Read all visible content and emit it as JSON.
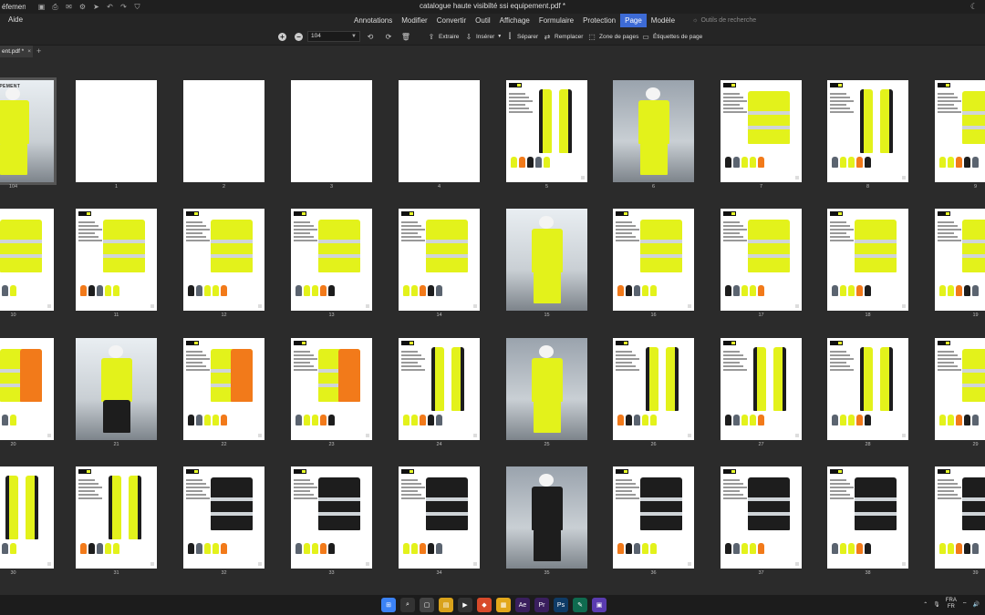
{
  "titlebar": {
    "app_name": "éfement",
    "document_title": "catalogue haute visibilté ssi equipement.pdf *",
    "quick_icons": [
      "save-icon",
      "print-icon",
      "mail-icon",
      "settings-icon",
      "send-icon",
      "undo-icon",
      "redo-icon",
      "shield-icon"
    ],
    "theme_icon": "moon-icon"
  },
  "menubar": {
    "aide": "Aide",
    "items": [
      "Annotations",
      "Modifier",
      "Convertir",
      "Outil",
      "Affichage",
      "Formulaire",
      "Protection",
      "Page",
      "Modèle"
    ],
    "active": "Page",
    "search_tools": "Outils de recherche"
  },
  "toolbar": {
    "zoom_value": "104",
    "buttons": [
      "Extraire",
      "Insérer",
      "Séparer",
      "Remplacer",
      "Zone de pages",
      "Étiquettes de page"
    ]
  },
  "tab": {
    "label": "ent.pdf *",
    "close": "×",
    "plus": "+"
  },
  "pages": {
    "labels": [
      [
        "104",
        "1",
        "2",
        "3",
        "4",
        "5",
        "6",
        "7",
        "8",
        "9"
      ],
      [
        "10",
        "11",
        "12",
        "13",
        "14",
        "15",
        "16",
        "17",
        "18",
        "19"
      ],
      [
        "20",
        "21",
        "22",
        "23",
        "24",
        "25",
        "26",
        "27",
        "28",
        "29"
      ],
      [
        "30",
        "31",
        "32",
        "33",
        "34",
        "35",
        "36",
        "37",
        "38",
        "39"
      ]
    ],
    "cover_text": "EQUIPEMENT"
  },
  "taskbar": {
    "lang_line1": "FRA",
    "lang_line2": "FR",
    "apps": [
      "windows-icon",
      "search-icon",
      "taskview-icon",
      "files-icon",
      "video-icon",
      "brave-icon",
      "explorer-icon",
      "ae-icon",
      "pr-icon",
      "ps-icon",
      "editor-icon",
      "pdf-icon"
    ]
  },
  "colors": {
    "accent": "#3d6bd6",
    "hivis_yellow": "#e3f21b",
    "hivis_orange": "#f27a1a",
    "dark_garment": "#1d1d1d"
  }
}
